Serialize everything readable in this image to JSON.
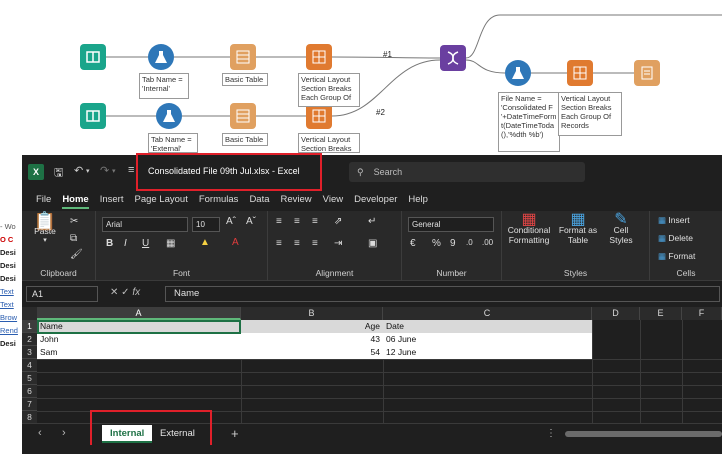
{
  "workflow": {
    "annotations": {
      "formula1": "Tab Name =\n'Internal'",
      "table1": "Basic Table",
      "layout1": "Vertical Layout\nSection Breaks\nEach Group Of",
      "formula2": "Tab Name =\n'External'",
      "table2": "Basic Table",
      "layout2": "Vertical Layout\nSection Breaks",
      "formula3": "File Name =\n'Consolidated F\n'+DateTimeForm\nt(DateTimeToda\n(),'%dth %b')",
      "layout3": "Vertical Layout\nSection Breaks\nEach Group Of\nRecords"
    },
    "connections": {
      "c1": "#1",
      "c2": "#2"
    }
  },
  "background_window": {
    "rows": [
      "- Wo",
      "O C",
      "Desi",
      "Desi",
      "Desi",
      "Text",
      "Text",
      "Brow",
      "Rend",
      "Desi"
    ]
  },
  "excel": {
    "title": "Consolidated File 09th Jul.xlsx  -  Excel",
    "search_placeholder": "Search",
    "menu": [
      "File",
      "Home",
      "Insert",
      "Page Layout",
      "Formulas",
      "Data",
      "Review",
      "View",
      "Developer",
      "Help"
    ],
    "active_menu": "Home",
    "ribbon": {
      "clipboard_label": "Clipboard",
      "paste_label": "Paste",
      "font_label": "Font",
      "font_name": "Arial",
      "font_size": "10",
      "alignment_label": "Alignment",
      "number_label": "Number",
      "number_format": "General",
      "styles_label": "Styles",
      "conditional_formatting": "Conditional Formatting",
      "format_as_table": "Format as Table",
      "cell_styles": "Cell Styles",
      "cells_label": "Cells",
      "insert": "Insert",
      "delete": "Delete",
      "format": "Format"
    },
    "name_box": "A1",
    "formula_value": "Name",
    "columns": [
      "A",
      "B",
      "C",
      "D",
      "E",
      "F"
    ],
    "rows": [
      "1",
      "2",
      "3",
      "4",
      "5",
      "6",
      "7",
      "8"
    ],
    "table": {
      "headers": [
        "Name",
        "Age",
        "Date"
      ],
      "data": [
        [
          "John",
          "43",
          "06 June"
        ],
        [
          "Sam",
          "54",
          "12 June"
        ]
      ]
    },
    "sheets": [
      "Internal",
      "External"
    ],
    "active_sheet": "Internal",
    "colors": {
      "brand_green": "#1e7145",
      "highlight_red": "#e0202a"
    }
  }
}
